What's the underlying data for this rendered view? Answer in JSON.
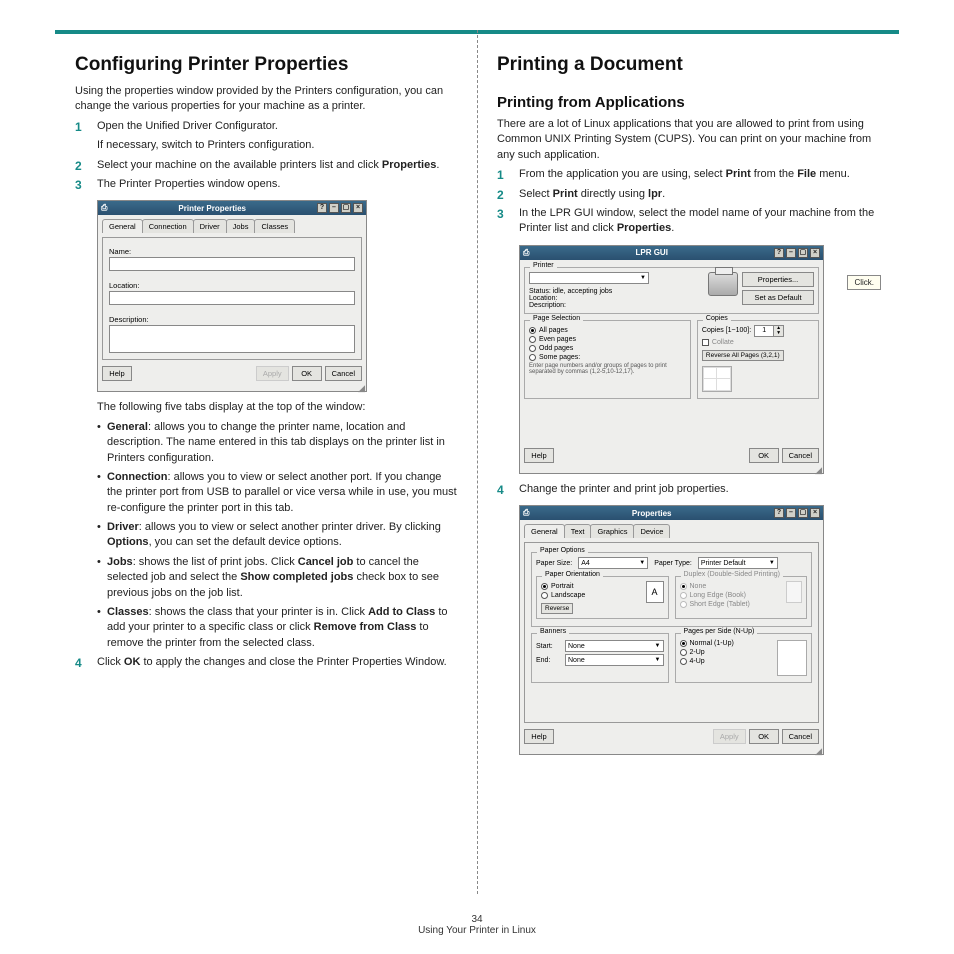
{
  "left": {
    "h1": "Configuring Printer Properties",
    "intro": "Using the properties window provided by the Printers configuration, you can change the various properties for your machine as a printer.",
    "step1": "Open the Unified Driver Configurator.",
    "step1_sub": "If necessary, switch to Printers configuration.",
    "step2_a": "Select your machine on the available printers list and click ",
    "step2_b": "Properties",
    "step2_c": ".",
    "step3": "The Printer Properties window opens.",
    "win1": {
      "title": "Printer Properties",
      "tabs": [
        "General",
        "Connection",
        "Driver",
        "Jobs",
        "Classes"
      ],
      "name": "Name:",
      "location": "Location:",
      "description": "Description:",
      "help": "Help",
      "apply": "Apply",
      "ok": "OK",
      "cancel": "Cancel"
    },
    "tabs_intro": "The following five tabs display at the top of the window:",
    "b_general_label": "General",
    "b_general": ": allows you to change the printer name, location and description. The name entered in this tab displays on the printer list in Printers configuration.",
    "b_conn_label": "Connection",
    "b_conn": ": allows you to view or select another port. If you change the printer port from USB to parallel or vice versa while in use, you must re-configure the printer port in this tab.",
    "b_driver_label": "Driver",
    "b_driver_a": ": allows you to view or select another printer driver. By clicking ",
    "b_driver_opt": "Options",
    "b_driver_b": ", you can set the default device options.",
    "b_jobs_label": "Jobs",
    "b_jobs_a": ": shows the list of print jobs. Click ",
    "b_jobs_cancel": "Cancel job",
    "b_jobs_b": " to cancel the selected job and select the ",
    "b_jobs_show": "Show completed jobs",
    "b_jobs_c": " check box to see previous jobs on the job list.",
    "b_classes_label": "Classes",
    "b_classes_a": ": shows the class that your printer is in. Click ",
    "b_classes_add": "Add to Class",
    "b_classes_b": " to add your printer to a specific class or click ",
    "b_classes_rem": "Remove from Class",
    "b_classes_c": " to remove the printer from the selected class.",
    "step4_a": "Click ",
    "step4_ok": "OK",
    "step4_b": " to apply the changes and close the Printer Properties Window."
  },
  "right": {
    "h1": "Printing a Document",
    "h2": "Printing from Applications",
    "intro": "There are a lot of Linux applications that you are allowed to print from using Common UNIX Printing System (CUPS). You can print on your machine from any such application.",
    "step1_a": "From the application you are using, select ",
    "step1_print": "Print",
    "step1_b": " from the ",
    "step1_file": "File",
    "step1_c": " menu.",
    "step2_a": "Select ",
    "step2_print": "Print",
    "step2_b": " directly using ",
    "step2_lpr": "lpr",
    "step2_c": ".",
    "step3_a": "In the LPR GUI window, select the model name of your machine from the Printer list and click ",
    "step3_prop": "Properties",
    "step3_b": ".",
    "callout": "Click.",
    "win2": {
      "title": "LPR GUI",
      "printer": "Printer",
      "properties": "Properties...",
      "setdefault": "Set as Default",
      "status_l": "Status:",
      "status_v": "idle, accepting jobs",
      "location": "Location:",
      "description": "Description:",
      "pagesel": "Page Selection",
      "allpages": "All pages",
      "even": "Even pages",
      "odd": "Odd pages",
      "some": "Some pages:",
      "hint": "Enter page numbers and/or groups of pages to print separated by commas (1,2-5,10-12,17).",
      "copies": "Copies",
      "copies_l": "Copies [1~100]:",
      "copies_v": "1",
      "collate": "Collate",
      "reverse": "Reverse All Pages (3,2,1)",
      "help": "Help",
      "ok": "OK",
      "cancel": "Cancel"
    },
    "step4": "Change the printer and print job properties.",
    "win3": {
      "title": "Properties",
      "tabs": [
        "General",
        "Text",
        "Graphics",
        "Device"
      ],
      "paperopt": "Paper Options",
      "psize": "Paper Size:",
      "psize_v": "A4",
      "ptype": "Paper Type:",
      "ptype_v": "Printer Default",
      "porient": "Paper Orientation",
      "portrait": "Portrait",
      "landscape": "Landscape",
      "reverse": "Reverse",
      "duplex": "Duplex (Double-Sided Printing)",
      "d_none": "None",
      "d_long": "Long Edge (Book)",
      "d_short": "Short Edge (Tablet)",
      "banners": "Banners",
      "start": "Start:",
      "end": "End:",
      "none": "None",
      "pps": "Pages per Side (N-Up)",
      "n1": "Normal (1-Up)",
      "n2": "2-Up",
      "n4": "4-Up",
      "help": "Help",
      "apply": "Apply",
      "ok": "OK",
      "cancel": "Cancel"
    }
  },
  "footer": {
    "page": "34",
    "section": "Using Your Printer in Linux"
  }
}
